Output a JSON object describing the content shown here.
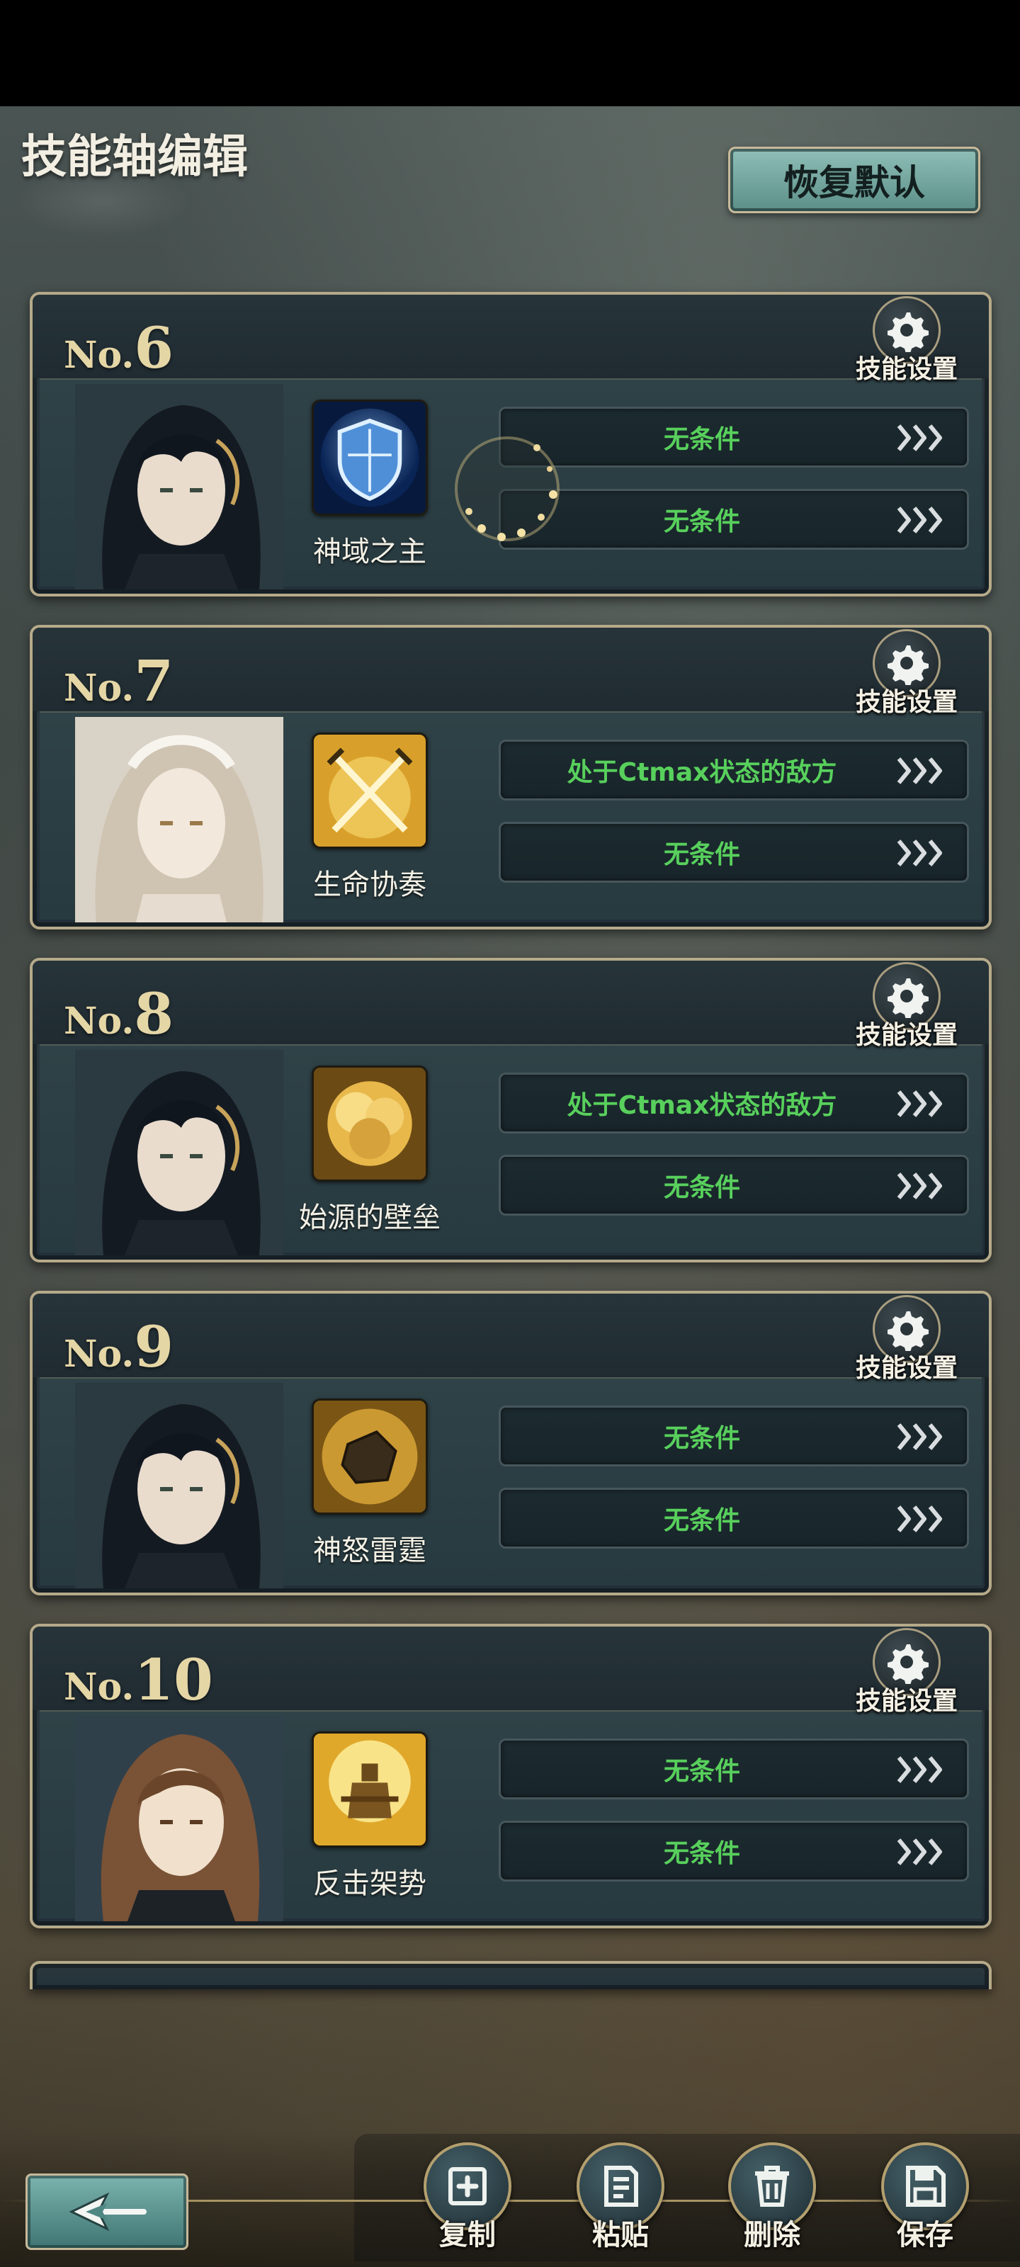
{
  "header": {
    "title": "技能轴编辑",
    "restore_label": "恢复默认"
  },
  "cards": [
    {
      "no_prefix": "No.",
      "number": "6",
      "settings_label": "技能设置",
      "skill_name": "神域之主",
      "skill_icon": "shield-icon",
      "portrait": "dark-haired-heroine",
      "conditions": [
        "无条件",
        "无条件"
      ]
    },
    {
      "no_prefix": "No.",
      "number": "7",
      "settings_label": "技能设置",
      "skill_name": "生命协奏",
      "skill_icon": "crossed-swords-icon",
      "portrait": "silver-haired-heroine",
      "conditions": [
        "处于Ctmax状态的敌方",
        "无条件"
      ]
    },
    {
      "no_prefix": "No.",
      "number": "8",
      "settings_label": "技能设置",
      "skill_name": "始源的壁垒",
      "skill_icon": "golden-burst-icon",
      "portrait": "dark-haired-heroine",
      "conditions": [
        "处于Ctmax状态的敌方",
        "无条件"
      ]
    },
    {
      "no_prefix": "No.",
      "number": "9",
      "settings_label": "技能设置",
      "skill_name": "神怒雷霆",
      "skill_icon": "boulder-strike-icon",
      "portrait": "dark-haired-heroine",
      "conditions": [
        "无条件",
        "无条件"
      ]
    },
    {
      "no_prefix": "No.",
      "number": "10",
      "settings_label": "技能设置",
      "skill_name": "反击架势",
      "skill_icon": "knight-stance-icon",
      "portrait": "brown-haired-heroine",
      "conditions": [
        "无条件",
        "无条件"
      ]
    }
  ],
  "bottom_bar": {
    "back_icon": "back-arrow-icon",
    "actions": [
      {
        "label": "复制",
        "icon": "copy-icon"
      },
      {
        "label": "粘贴",
        "icon": "paste-icon"
      },
      {
        "label": "删除",
        "icon": "trash-icon"
      },
      {
        "label": "保存",
        "icon": "save-icon"
      }
    ]
  },
  "colors": {
    "condition_text": "#58d05c",
    "card_border": "#b6aa8a",
    "number_gold": "#e5d6a6",
    "restore_button": "#6fa39c"
  }
}
